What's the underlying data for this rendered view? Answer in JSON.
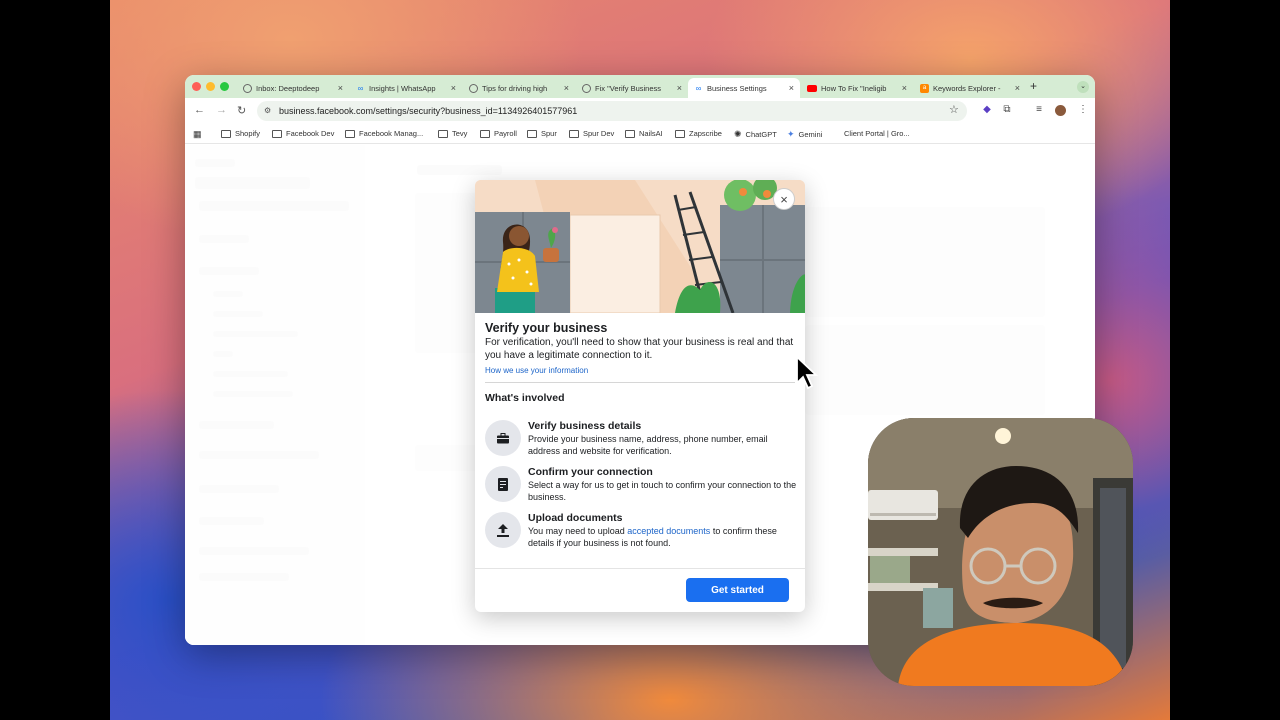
{
  "tabs": [
    {
      "title": "Inbox: Deeptodeep",
      "icon": "messenger-icon",
      "active": false
    },
    {
      "title": "Insights | WhatsApp",
      "icon": "meta-icon",
      "active": false
    },
    {
      "title": "Tips for driving high",
      "icon": "messenger-icon",
      "active": false
    },
    {
      "title": "Fix \"Verify Business",
      "icon": "messenger-icon",
      "active": false
    },
    {
      "title": "Business Settings",
      "icon": "meta-icon",
      "active": true
    },
    {
      "title": "How To Fix \"Ineligib",
      "icon": "youtube-icon",
      "active": false
    },
    {
      "title": "Keywords Explorer -",
      "icon": "ahrefs-icon",
      "active": false
    }
  ],
  "omnibox": {
    "url": "business.facebook.com/settings/security?business_id=1134926401577961"
  },
  "bookmarks": [
    {
      "label": "Shopify",
      "type": "folder"
    },
    {
      "label": "Facebook Dev",
      "type": "folder"
    },
    {
      "label": "Facebook Manag...",
      "type": "folder"
    },
    {
      "label": "Tevy",
      "type": "folder"
    },
    {
      "label": "Payroll",
      "type": "folder"
    },
    {
      "label": "Spur",
      "type": "folder"
    },
    {
      "label": "Spur Dev",
      "type": "folder"
    },
    {
      "label": "NailsAI",
      "type": "folder"
    },
    {
      "label": "Zapscribe",
      "type": "folder"
    },
    {
      "label": "ChatGPT",
      "type": "site"
    },
    {
      "label": "Gemini",
      "type": "site"
    },
    {
      "label": "Client Portal | Gro...",
      "type": "site"
    }
  ],
  "modal": {
    "title": "Verify your business",
    "description": "For verification, you'll need to show that your business is real and that you have a legitimate connection to it.",
    "info_link": "How we use your information",
    "section_heading": "What's involved",
    "steps": [
      {
        "icon": "briefcase-icon",
        "title": "Verify business details",
        "desc": "Provide your business name, address, phone number, email address and website for verification."
      },
      {
        "icon": "document-icon",
        "title": "Confirm your connection",
        "desc": "Select a way for us to get in touch to confirm your connection to the business."
      },
      {
        "icon": "upload-icon",
        "title": "Upload documents",
        "desc_before": "You may need to upload ",
        "desc_link": "accepted documents",
        "desc_after": " to confirm these details if your business is not found."
      }
    ],
    "cta": "Get started"
  },
  "colors": {
    "accent": "#1a6ff0",
    "link": "#1d65c9",
    "tabstrip": "#d6ecd4"
  }
}
